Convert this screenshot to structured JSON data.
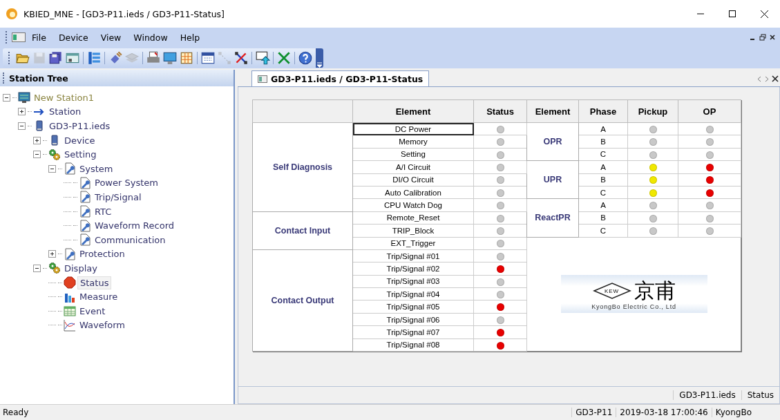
{
  "window": {
    "title": "KBIED_MNE - [GD3-P11.ieds / GD3-P11-Status]"
  },
  "menu": [
    "File",
    "Device",
    "View",
    "Window",
    "Help"
  ],
  "toolbar": [
    {
      "kind": "open",
      "disabled": false
    },
    {
      "kind": "save",
      "disabled": true
    },
    {
      "kind": "save-all",
      "disabled": false
    },
    {
      "kind": "window",
      "disabled": false
    },
    {
      "kind": "sep"
    },
    {
      "kind": "list",
      "disabled": false
    },
    {
      "kind": "sep"
    },
    {
      "kind": "plug",
      "disabled": false
    },
    {
      "kind": "stack",
      "disabled": true
    },
    {
      "kind": "sep"
    },
    {
      "kind": "printer",
      "disabled": false
    },
    {
      "kind": "monitor",
      "disabled": false
    },
    {
      "kind": "grid",
      "disabled": false
    },
    {
      "kind": "sep"
    },
    {
      "kind": "calendar",
      "disabled": false
    },
    {
      "kind": "connect",
      "disabled": true
    },
    {
      "kind": "disconnect",
      "disabled": false
    },
    {
      "kind": "sep"
    },
    {
      "kind": "upload",
      "disabled": false
    },
    {
      "kind": "sep"
    },
    {
      "kind": "cross",
      "disabled": false
    },
    {
      "kind": "sep"
    },
    {
      "kind": "help",
      "disabled": false
    }
  ],
  "station_tree": {
    "title": "Station Tree",
    "items": [
      {
        "label": "New Station1",
        "kind": "station",
        "expanded": true,
        "selected": false,
        "children": [
          {
            "label": "Station",
            "kind": "arrow",
            "expanded": false,
            "selected": false
          },
          {
            "label": "GD3-P11.ieds",
            "kind": "device",
            "expanded": true,
            "selected": false,
            "children": [
              {
                "label": "Device",
                "kind": "device",
                "expanded": false,
                "selected": false
              },
              {
                "label": "Setting",
                "kind": "gears",
                "expanded": true,
                "selected": false,
                "children": [
                  {
                    "label": "System",
                    "kind": "wrench",
                    "expanded": true,
                    "selected": false,
                    "children": [
                      {
                        "label": "Power System",
                        "kind": "wrench",
                        "selected": false
                      },
                      {
                        "label": "Trip/Signal",
                        "kind": "wrench",
                        "selected": false
                      },
                      {
                        "label": "RTC",
                        "kind": "wrench",
                        "selected": false
                      },
                      {
                        "label": "Waveform Record",
                        "kind": "wrench",
                        "selected": false
                      },
                      {
                        "label": "Communication",
                        "kind": "wrench",
                        "selected": false
                      }
                    ]
                  },
                  {
                    "label": "Protection",
                    "kind": "wrench",
                    "expanded": false,
                    "selected": false
                  }
                ]
              },
              {
                "label": "Display",
                "kind": "gears",
                "expanded": true,
                "selected": false,
                "children": [
                  {
                    "label": "Status",
                    "kind": "stop",
                    "selected": true
                  },
                  {
                    "label": "Measure",
                    "kind": "bars",
                    "selected": false
                  },
                  {
                    "label": "Event",
                    "kind": "table",
                    "selected": false
                  },
                  {
                    "label": "Waveform",
                    "kind": "wave",
                    "selected": false
                  }
                ]
              }
            ]
          }
        ]
      }
    ]
  },
  "tab": {
    "label": "GD3-P11.ieds / GD3-P11-Status",
    "selected": true
  },
  "status_table": {
    "columns": [
      "Element",
      "Status",
      "Element",
      "Phase",
      "Pickup",
      "OP"
    ],
    "groups": [
      {
        "name": "Self Diagnosis",
        "rows": [
          {
            "element": "DC Power",
            "color": "#c8c8c8",
            "selected": true
          },
          {
            "element": "Memory",
            "color": "#c8c8c8",
            "selected": false
          },
          {
            "element": "Setting",
            "color": "#c8c8c8",
            "selected": false
          },
          {
            "element": "A/I Circuit",
            "color": "#c8c8c8",
            "selected": false
          },
          {
            "element": "DI/O Circuit",
            "color": "#c8c8c8",
            "selected": false
          },
          {
            "element": "Auto Calibration",
            "color": "#c8c8c8",
            "selected": false
          },
          {
            "element": "CPU Watch Dog",
            "color": "#c8c8c8",
            "selected": false
          }
        ]
      },
      {
        "name": "Contact Input",
        "rows": [
          {
            "element": "Remote_Reset",
            "color": "#c8c8c8",
            "selected": false
          },
          {
            "element": "TRIP_Block",
            "color": "#c8c8c8",
            "selected": false
          },
          {
            "element": "EXT_Trigger",
            "color": "#c8c8c8",
            "selected": false
          }
        ]
      },
      {
        "name": "Contact Output",
        "rows": [
          {
            "element": "Trip/Signal #01",
            "color": "#c8c8c8",
            "selected": false
          },
          {
            "element": "Trip/Signal #02",
            "color": "#e80000",
            "selected": false
          },
          {
            "element": "Trip/Signal #03",
            "color": "#c8c8c8",
            "selected": false
          },
          {
            "element": "Trip/Signal #04",
            "color": "#c8c8c8",
            "selected": false
          },
          {
            "element": "Trip/Signal #05",
            "color": "#e80000",
            "selected": false
          },
          {
            "element": "Trip/Signal #06",
            "color": "#c8c8c8",
            "selected": false
          },
          {
            "element": "Trip/Signal #07",
            "color": "#e80000",
            "selected": false
          },
          {
            "element": "Trip/Signal #08",
            "color": "#e80000",
            "selected": false
          }
        ]
      }
    ],
    "protection": [
      {
        "name": "OPR",
        "phases": [
          {
            "phase": "A",
            "pickup": {
              "color": "#c8c8c8"
            },
            "op": {
              "color": "#c8c8c8"
            }
          },
          {
            "phase": "B",
            "pickup": {
              "color": "#c8c8c8"
            },
            "op": {
              "color": "#c8c8c8"
            }
          },
          {
            "phase": "C",
            "pickup": {
              "color": "#c8c8c8"
            },
            "op": {
              "color": "#c8c8c8"
            }
          }
        ]
      },
      {
        "name": "UPR",
        "phases": [
          {
            "phase": "A",
            "pickup": {
              "color": "#f0e800"
            },
            "op": {
              "color": "#e80000"
            }
          },
          {
            "phase": "B",
            "pickup": {
              "color": "#f0e800"
            },
            "op": {
              "color": "#e80000"
            }
          },
          {
            "phase": "C",
            "pickup": {
              "color": "#f0e800"
            },
            "op": {
              "color": "#e80000"
            }
          }
        ]
      },
      {
        "name": "ReactPR",
        "phases": [
          {
            "phase": "A",
            "pickup": {
              "color": "#c8c8c8"
            },
            "op": {
              "color": "#c8c8c8"
            }
          },
          {
            "phase": "B",
            "pickup": {
              "color": "#c8c8c8"
            },
            "op": {
              "color": "#c8c8c8"
            }
          },
          {
            "phase": "C",
            "pickup": {
              "color": "#c8c8c8"
            },
            "op": {
              "color": "#c8c8c8"
            }
          }
        ]
      }
    ],
    "logo": {
      "mark": "KEW",
      "name": "京甫",
      "company": "KyongBo Electric Co., Ltd"
    }
  },
  "pane_status": [
    "GD3-P11.ieds",
    "Status"
  ],
  "status_bar": {
    "message": "Ready",
    "fields": [
      "GD3-P11",
      "2019-03-18 17:00:46",
      "KyongBo"
    ]
  }
}
